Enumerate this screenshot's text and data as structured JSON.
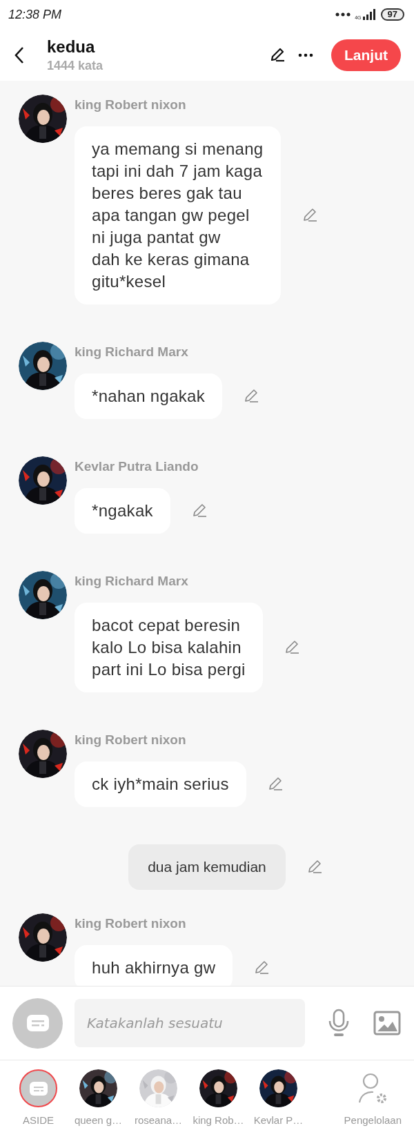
{
  "status_bar": {
    "time": "12:38 PM",
    "network": "4G",
    "battery": "97"
  },
  "header": {
    "title": "kedua",
    "subtitle": "1444 kata",
    "next_button": "Lanjut"
  },
  "messages": [
    {
      "kind": "character",
      "sender": "king Robert nixon",
      "text": "ya memang si menang\ntapi ini dah 7 jam kaga\nberes beres gak tau\napa tangan gw pegel\nni juga pantat gw\ndah ke keras gimana\ngitu*kesel"
    },
    {
      "kind": "character",
      "sender": "king Richard Marx",
      "text": "*nahan ngakak"
    },
    {
      "kind": "character",
      "sender": "Kevlar Putra Liando",
      "text": "*ngakak"
    },
    {
      "kind": "character",
      "sender": "king Richard Marx",
      "text": "bacot cepat beresin\nkalo Lo bisa kalahin\npart ini Lo bisa pergi"
    },
    {
      "kind": "character",
      "sender": "king Robert nixon",
      "text": "ck iyh*main serius"
    },
    {
      "kind": "narration",
      "text": "dua jam kemudian"
    },
    {
      "kind": "character",
      "sender": "king Robert nixon",
      "text": "huh akhirnya gw"
    }
  ],
  "composer": {
    "placeholder": "Katakanlah sesuatu"
  },
  "cast": [
    {
      "kind": "aside",
      "label": "ASIDE",
      "selected": true
    },
    {
      "kind": "character",
      "label": "queen g…",
      "selected": false
    },
    {
      "kind": "character",
      "label": "roseana…",
      "selected": false
    },
    {
      "kind": "character",
      "label": "king Rob…",
      "selected": false
    },
    {
      "kind": "character",
      "label": "Kevlar P…",
      "selected": false
    }
  ],
  "manage": {
    "label": "Pengelolaan"
  }
}
